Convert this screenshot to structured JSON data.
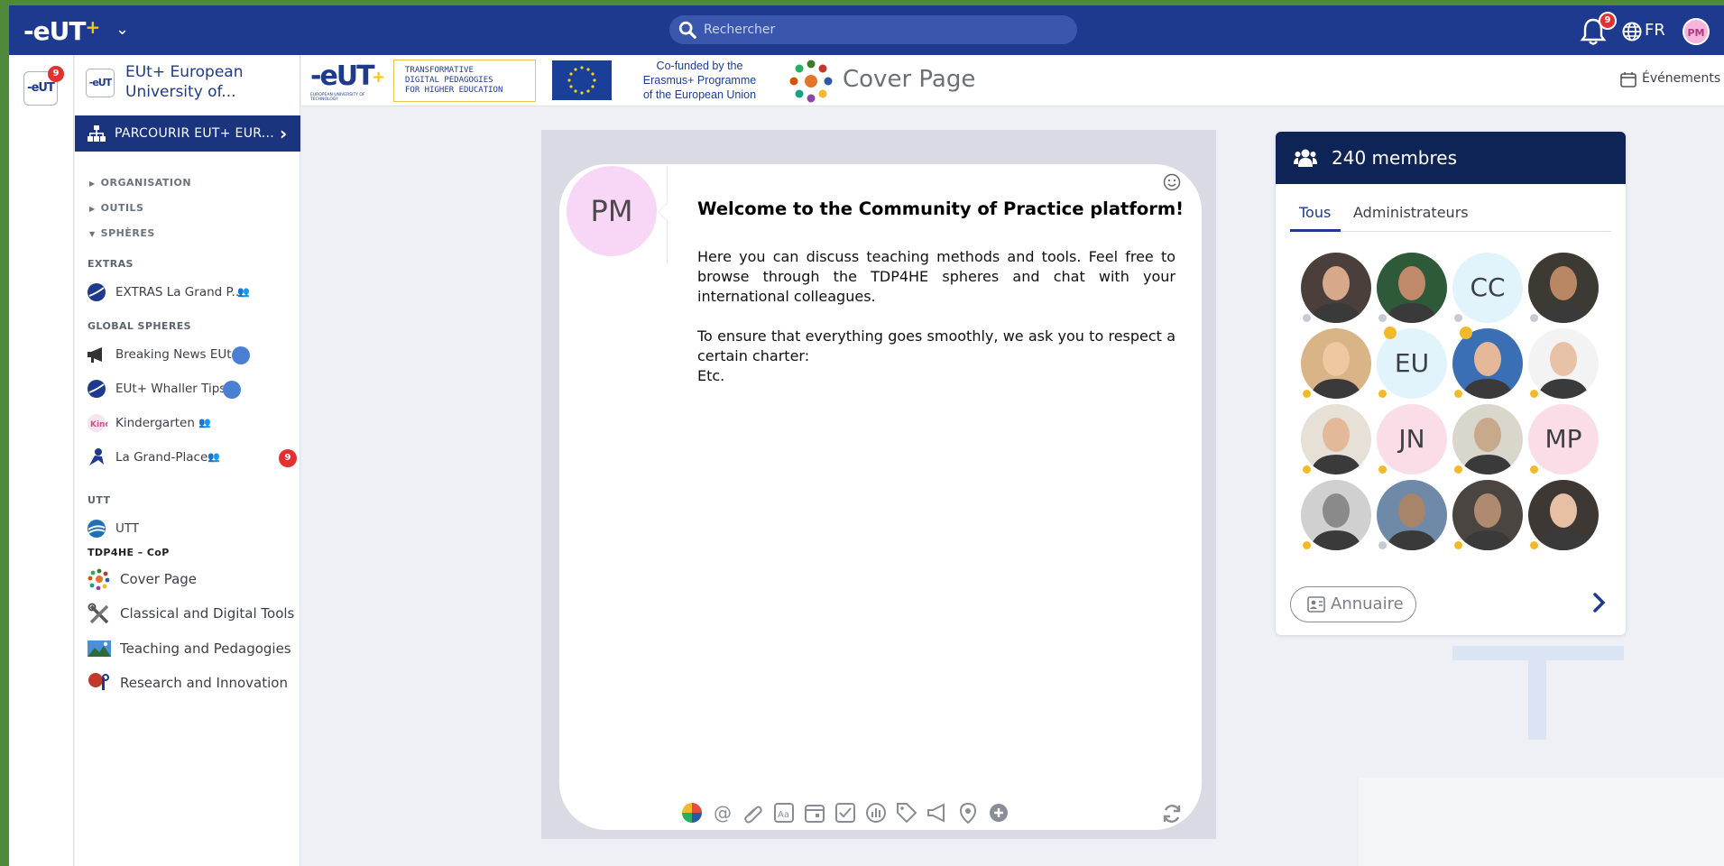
{
  "topbar": {
    "logo": "-eUT",
    "logo_plus": "+",
    "search_placeholder": "Rechercher",
    "notification_count": "9",
    "language": "FR",
    "user_initials": "PM"
  },
  "rail": {
    "logo": "-eUT",
    "badge_count": "9"
  },
  "sidebar": {
    "community_logo": "-eUT",
    "community_name": "EUt+ European University of...",
    "browse_label": "PARCOURIR EUT+ EUR...",
    "sections": [
      {
        "label": "ORGANISATION",
        "state": "collapsed"
      },
      {
        "label": "OUTILS",
        "state": "collapsed"
      },
      {
        "label": "SPHÈRES",
        "state": "expanded"
      }
    ],
    "groups": {
      "extras": "EXTRAS",
      "global": "GLOBAL SPHERES",
      "utt": "UTT",
      "tdp": "TDP4HE – CoP"
    },
    "extras_items": [
      {
        "label": "EXTRAS La Grand P...",
        "type": "community"
      }
    ],
    "global_items": [
      {
        "label": "Breaking News EUt+",
        "type": "channel"
      },
      {
        "label": "EUt+ Whaller Tips",
        "type": "channel"
      },
      {
        "label": "Kindergarten",
        "type": "community"
      },
      {
        "label": "La Grand-Place",
        "type": "community",
        "badge": "9"
      }
    ],
    "utt_items": [
      {
        "label": "UTT"
      }
    ],
    "tdp_items": [
      {
        "label": "Cover Page",
        "icon": "people-circle-icon"
      },
      {
        "label": "Classical and Digital Tools",
        "icon": "tools-icon"
      },
      {
        "label": "Teaching and Pedagogies",
        "icon": "landscape-icon"
      },
      {
        "label": "Research and Innovation",
        "icon": "research-icon"
      }
    ]
  },
  "header": {
    "banner_eut": "-eUT",
    "banner_eut_plus": "+",
    "banner_eut_caption": "EUROPEAN UNIVERSITY OF TECHNOLOGY",
    "banner_tdp": [
      "TRANSFORMATIVE",
      "DIGITAL PEDAGOGIES",
      "FOR HIGHER EDUCATION"
    ],
    "eu_text": [
      "Co-funded by the",
      "Erasmus+ Programme",
      "of the European Union"
    ],
    "page_title": "Cover Page",
    "events_label": "Événements"
  },
  "wall": {
    "author_initials": "PM",
    "title": "Welcome to the Community of Practice platform!",
    "paragraphs": [
      "Here you can discuss teaching methods and tools. Feel free to browse through the TDP4HE spheres and chat with your international colleagues.",
      "To ensure that everything goes smoothly, we ask you to respect a certain charter:"
    ],
    "closing": "Etc.",
    "tools": [
      "palette-icon",
      "at-icon",
      "paperclip-icon",
      "text-format-icon",
      "calendar-icon",
      "checkbox-icon",
      "poll-icon",
      "tag-icon",
      "megaphone-icon",
      "location-icon",
      "plus-circle-icon"
    ]
  },
  "members": {
    "count_label": "240 membres",
    "tabs": [
      "Tous",
      "Administrateurs"
    ],
    "active_tab": "Tous",
    "grid": [
      {
        "type": "photo",
        "color": "#4b3f3c",
        "skin": "#d7a88a",
        "dot": "#c7cad3"
      },
      {
        "type": "photo",
        "color": "#2f5a3a",
        "skin": "#c08a6a",
        "dot": "#c7cad3"
      },
      {
        "type": "initials",
        "initials": "CC",
        "bg": "#e2f4fb",
        "dot": "#c7cad3"
      },
      {
        "type": "photo",
        "color": "#3d3a33",
        "skin": "#b98763",
        "dot": "#c7cad3"
      },
      {
        "type": "photo",
        "color": "#d8b486",
        "skin": "#f0c7a0",
        "dot": "#f2b92b"
      },
      {
        "type": "initials",
        "initials": "EU",
        "bg": "#e2f4fb",
        "dot": "#f2b92b",
        "admin": true
      },
      {
        "type": "photo",
        "color": "#3b6fb5",
        "skin": "#e5b89a",
        "dot": "#f2b92b",
        "admin": true
      },
      {
        "type": "photo",
        "color": "#f3f3f3",
        "skin": "#e7c2a7",
        "dot": "#f2b92b"
      },
      {
        "type": "photo",
        "color": "#e6e0d6",
        "skin": "#e4b99a",
        "dot": "#f2b92b"
      },
      {
        "type": "initials",
        "initials": "JN",
        "bg": "#fbdde7",
        "dot": "#f2b92b"
      },
      {
        "type": "photo",
        "color": "#d9d6cc",
        "skin": "#c9a98c",
        "dot": "#f2b92b"
      },
      {
        "type": "initials",
        "initials": "MP",
        "bg": "#fbdde7",
        "dot": "#f2b92b"
      },
      {
        "type": "photo",
        "color": "#d0d0d0",
        "skin": "#8a8a8a",
        "dot": "#f2b92b"
      },
      {
        "type": "photo",
        "color": "#6e8aa8",
        "skin": "#a88468",
        "dot": "#c7cad3"
      },
      {
        "type": "photo",
        "color": "#4a4540",
        "skin": "#b08a6e",
        "dot": "#f2b92b"
      },
      {
        "type": "photo",
        "color": "#3e3834",
        "skin": "#e6bfa4",
        "dot": "#f2b92b"
      }
    ],
    "directory_label": "Annuaire"
  },
  "colors": {
    "topbar": "#1e3a8f",
    "sidebar_active": "#1a347e",
    "members_header": "#0f2456",
    "badge_red": "#e53030",
    "accent_yellow": "#f4c313"
  }
}
